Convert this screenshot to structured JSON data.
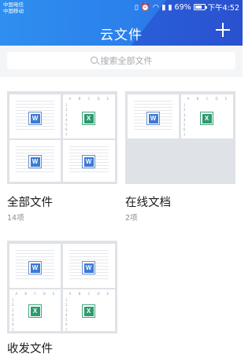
{
  "status_bar": {
    "carrier_1": "中国电信",
    "carrier_2": "中国移动",
    "battery": "69%",
    "time": "下午4:52",
    "icons": [
      "wifi-icon",
      "alarm-icon",
      "signal-icon",
      "battery-icon"
    ]
  },
  "header": {
    "title": "云文件",
    "add_icon": "plus-icon"
  },
  "search": {
    "placeholder": "搜索全部文件"
  },
  "folders": [
    {
      "name": "全部文件",
      "count": "14项"
    },
    {
      "name": "在线文档",
      "count": "2项"
    },
    {
      "name": "收发文件",
      "count": ""
    }
  ],
  "file_icons": {
    "word_letter": "W",
    "excel_letter": "X"
  },
  "colors": {
    "header_start": "#2f8ff0",
    "header_end": "#2e60d8",
    "word": "#3a7bd5",
    "excel": "#2f9a6c"
  }
}
